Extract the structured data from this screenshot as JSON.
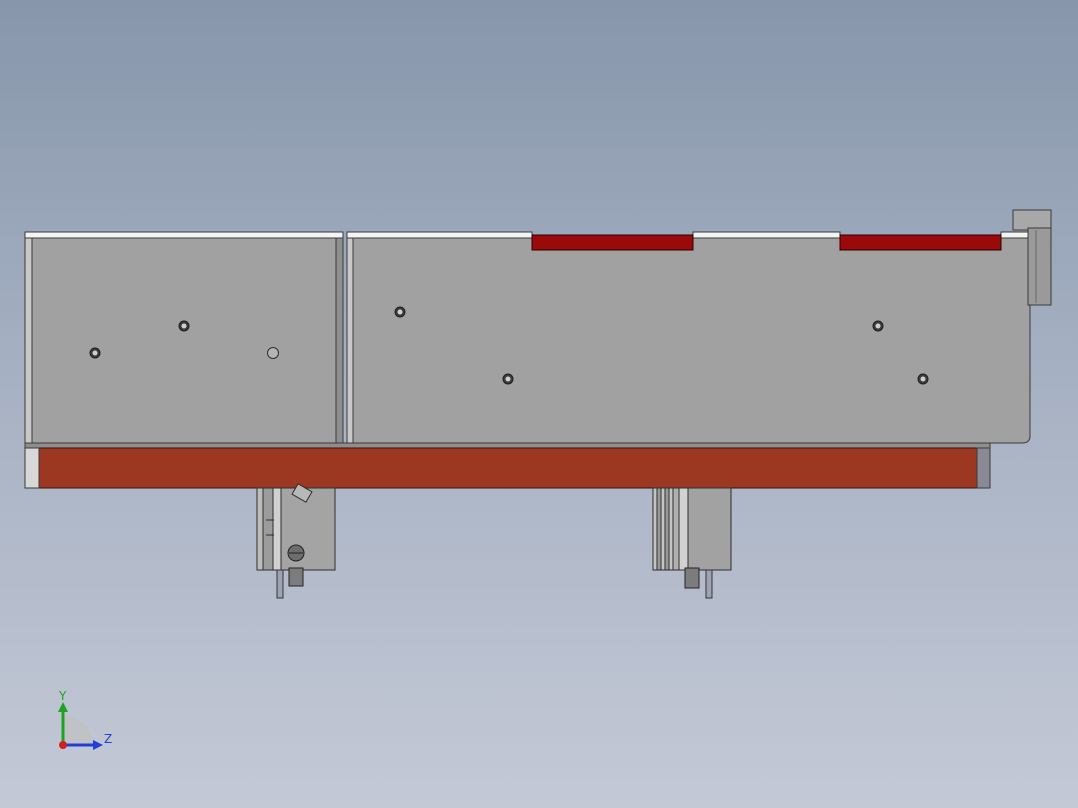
{
  "triad": {
    "y_label": "Y",
    "z_label": "Z",
    "colors": {
      "y": "#1fa31f",
      "z": "#1f3fd6",
      "x": "#d12020"
    }
  },
  "model": {
    "colors": {
      "panel_face": "#a0a0a0",
      "panel_edge": "#3a3a3a",
      "top_cover": "#f4f4f4",
      "red_strip": "#9a0a0a",
      "base_plate": "#9c3822",
      "end_cap": "#d8d8d8",
      "motor_body": "#8a8a8a"
    }
  }
}
